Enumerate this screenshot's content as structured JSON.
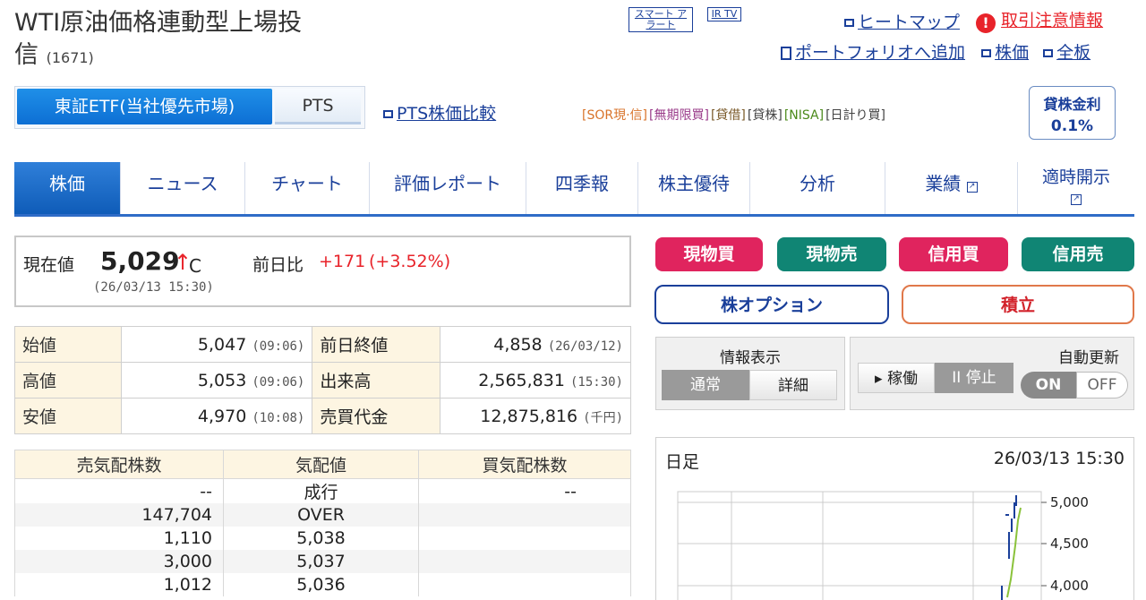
{
  "header": {
    "title_line1": "WTI原油価格連動型上場投",
    "title_line2": "信",
    "code": "(1671)",
    "smart_alert": "スマート アラート",
    "ir_tv": "IR TV",
    "heatmap": "ヒートマップ",
    "caution": "取引注意情報",
    "portfolio": "ポートフォリオへ追加",
    "kabuka": "株価",
    "zenban": "全板"
  },
  "market_tabs": {
    "tse": "東証ETF(当社優先市場)",
    "pts": "PTS"
  },
  "pts_compare": "PTS株価比較",
  "tags": [
    "[SOR現·信]",
    "[無期限買]",
    "[貸借]",
    "[貸株]",
    "[NISA]",
    "[日計り買]"
  ],
  "lending_rate": {
    "label": "貸株金利",
    "value": "0.1%"
  },
  "nav_tabs": [
    "株価",
    "ニュース",
    "チャート",
    "評価レポート",
    "四季報",
    "株主優待",
    "分析",
    "業績",
    "適時開示"
  ],
  "price": {
    "label": "現在値",
    "value": "5,029",
    "arrow": "↑",
    "flag": "C",
    "datetime": "(26/03/13 15:30)",
    "change_label": "前日比",
    "change": "+171",
    "change_pct": "(+3.52%)"
  },
  "info": [
    {
      "l1": "始値",
      "v1": "5,047",
      "t1": "(09:06)",
      "l2": "前日終値",
      "v2": "4,858",
      "t2": "(26/03/12)"
    },
    {
      "l1": "高値",
      "v1": "5,053",
      "t1": "(09:06)",
      "l2": "出来高",
      "v2": "2,565,831",
      "t2": "(15:30)"
    },
    {
      "l1": "安値",
      "v1": "4,970",
      "t1": "(10:08)",
      "l2": "売買代金",
      "v2": "12,875,816",
      "t2": "(千円)"
    }
  ],
  "board": {
    "headers": [
      "売気配株数",
      "気配値",
      "買気配株数"
    ],
    "rows": [
      {
        "sell": "--",
        "price": "成行",
        "buy": "--"
      },
      {
        "sell": "147,704",
        "price": "OVER",
        "buy": ""
      },
      {
        "sell": "1,110",
        "price": "5,038",
        "buy": ""
      },
      {
        "sell": "3,000",
        "price": "5,037",
        "buy": ""
      },
      {
        "sell": "1,012",
        "price": "5,036",
        "buy": ""
      }
    ]
  },
  "trade_buttons": [
    "現物買",
    "現物売",
    "信用買",
    "信用売"
  ],
  "option_buttons": {
    "option": "株オプション",
    "tsumitate": "積立"
  },
  "info_display": {
    "label": "情報表示",
    "normal": "通常",
    "detail": "詳細"
  },
  "auto_update": {
    "label": "自動更新",
    "run": "▸ 稼働",
    "stop": "II 停止",
    "on": "ON",
    "off": "OFF"
  },
  "chart": {
    "label": "日足",
    "datetime": "26/03/13 15:30",
    "yticks": [
      "5,000",
      "4,500",
      "4,000"
    ]
  },
  "colors": {
    "brand_blue": "#1a3f9a",
    "up_red": "#e8232a",
    "buy_red": "#e0245e",
    "sell_green": "#108574"
  }
}
